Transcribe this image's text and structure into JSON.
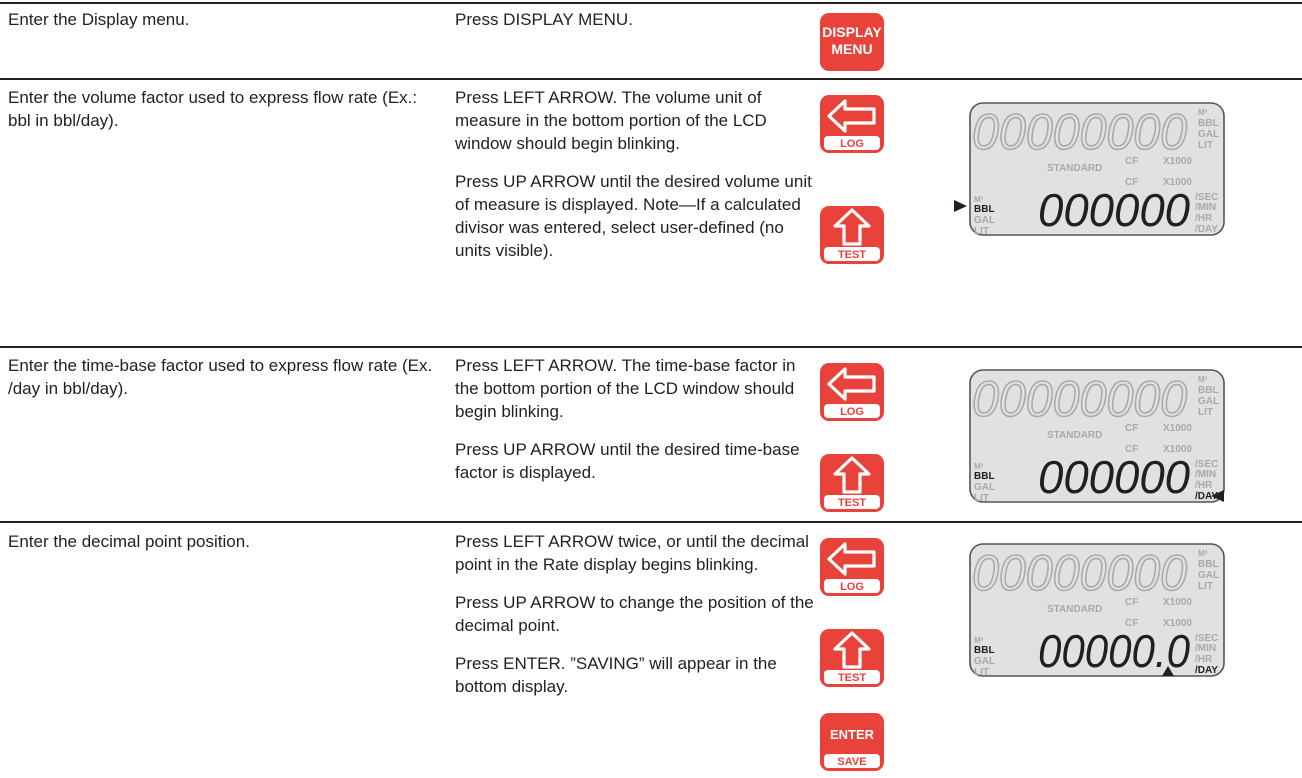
{
  "rows": [
    {
      "action": "Enter the Display menu.",
      "steps": [
        "Press DISPLAY MENU."
      ]
    },
    {
      "action": "Enter the volume factor used to express flow rate (Ex.: bbl in bbl/day).",
      "steps": [
        "Press LEFT ARROW. The volume unit of measure in the bottom portion of the LCD window should begin blinking.",
        "Press UP ARROW until the desired volume unit of measure is displayed. Note—If a calculated divisor was entered, select user-defined (no units visible)."
      ]
    },
    {
      "action": "Enter the time-base factor used to express flow rate (Ex. /day in bbl/day).",
      "steps": [
        "Press LEFT ARROW. The time-base factor in the bottom portion of the LCD window should begin blinking.",
        "Press UP ARROW until the desired time-base factor is displayed."
      ]
    },
    {
      "action": "Enter the decimal point position.",
      "steps": [
        "Press LEFT ARROW twice, or until the decimal point in the Rate display begins blinking.",
        "Press UP ARROW to change the position of the decimal point.",
        "Press ENTER. ”SAVING” will appear in the bottom display."
      ]
    }
  ],
  "buttons": {
    "display_menu": {
      "line1": "DISPLAY",
      "line2": "MENU"
    },
    "log": {
      "label": "LOG",
      "icon": "left-arrow-icon"
    },
    "test": {
      "label": "TEST",
      "icon": "up-arrow-icon"
    },
    "enter": {
      "main": "ENTER",
      "label": "SAVE"
    }
  },
  "lcd": {
    "top_digits": "00000000",
    "bottom_digits": "000000",
    "bottom_digits_decimal": "00000.0",
    "units_top": [
      "M³",
      "BBL",
      "GAL",
      "LIT"
    ],
    "standard": "STANDARD",
    "cf": "CF",
    "x1000": "X1000",
    "units_volume": [
      "M³",
      "BBL",
      "GAL",
      "LIT"
    ],
    "units_time": [
      "/SEC",
      "/MIN",
      "/HR",
      "/DAY"
    ]
  },
  "colors": {
    "button_red": "#e8423b",
    "lcd_bg": "#e1e1e1",
    "lcd_segment": "#a9a9a9",
    "text": "#231f20"
  }
}
